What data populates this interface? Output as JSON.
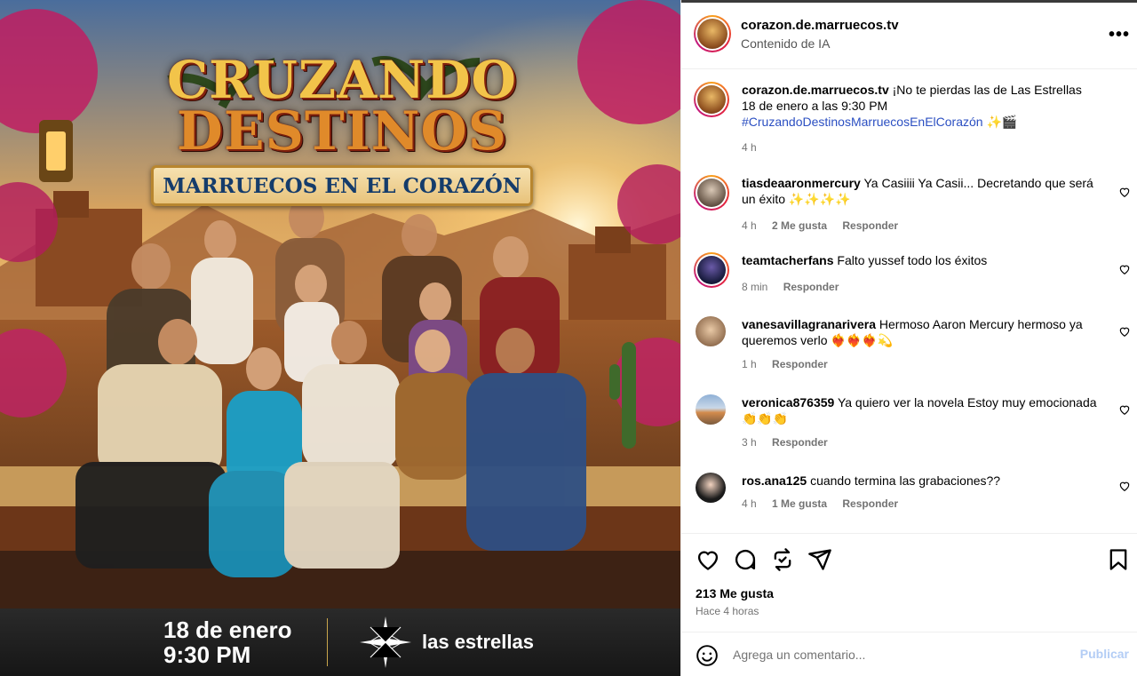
{
  "post_image": {
    "title_line1": "CRUZANDO",
    "title_line2": "DESTINOS",
    "subtitle": "MARRUECOS EN EL CORAZÓN",
    "date_line1": "18 de enero",
    "date_line2": "9:30 PM",
    "channel": "las estrellas"
  },
  "header": {
    "username": "corazon.de.marruecos.tv",
    "subtitle": "Contenido de IA",
    "more_icon": "more-horizontal-icon"
  },
  "caption": {
    "username": "corazon.de.marruecos.tv",
    "text_line1": "¡No te pierdas las de Las Estrellas",
    "text_line2": "18 de enero a las 9:30 PM",
    "hashtag": "#CruzandoDestinosMarruecosEnElCorazón",
    "emoji": "✨🎬",
    "time": "4 h"
  },
  "comments": [
    {
      "username": "tiasdeaaronmercury",
      "text": "Ya Casiiii Ya Casii... Decretando que será un éxito ✨✨✨✨",
      "time": "4 h",
      "likes": "2 Me gusta",
      "reply": "Responder"
    },
    {
      "username": "teamtacherfans",
      "text": "Falto yussef todo los éxitos",
      "time": "8 min",
      "likes": "",
      "reply": "Responder"
    },
    {
      "username": "vanesavillagranarivera",
      "text": "Hermoso Aaron Mercury hermoso ya queremos verlo ❤️‍🔥❤️‍🔥❤️‍🔥💫",
      "time": "1 h",
      "likes": "",
      "reply": "Responder"
    },
    {
      "username": "veronica876359",
      "text": "Ya quiero ver la novela Estoy muy emocionada👏👏👏",
      "time": "3 h",
      "likes": "",
      "reply": "Responder"
    },
    {
      "username": "ros.ana125",
      "text": "cuando termina las grabaciones??",
      "time": "4 h",
      "likes": "1 Me gusta",
      "reply": "Responder"
    }
  ],
  "actions": {
    "likes": "213 Me gusta",
    "time": "Hace 4 horas"
  },
  "composer": {
    "placeholder": "Agrega un comentario...",
    "publish": "Publicar"
  },
  "colors": {
    "hashtag": "#2b4fc2",
    "publish_disabled": "#b3cdf5",
    "muted": "#737373"
  }
}
